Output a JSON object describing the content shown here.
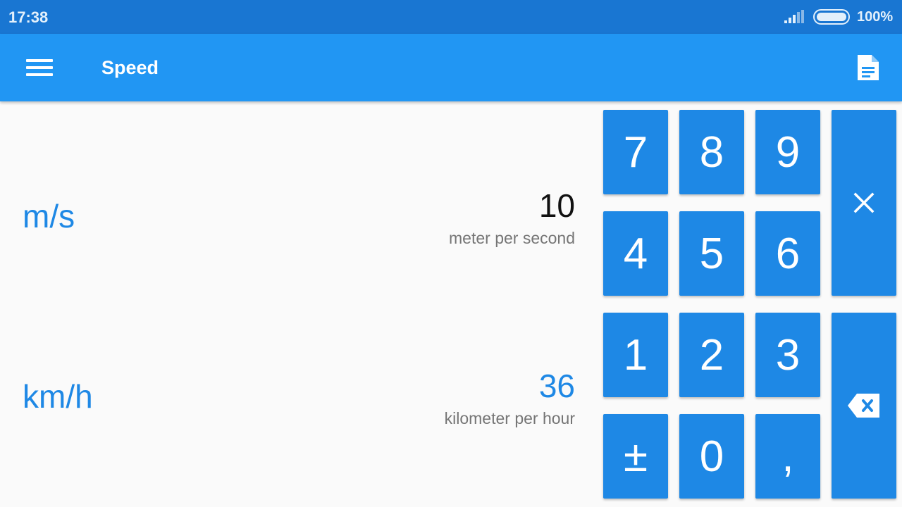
{
  "status": {
    "time": "17:38",
    "battery": "100%"
  },
  "app": {
    "title": "Speed",
    "menu_icon": "hamburger-menu-icon",
    "doc_icon": "document-icon"
  },
  "conversions": [
    {
      "unit": "m/s",
      "value": "10",
      "name": "meter per second",
      "value_color": "#111111"
    },
    {
      "unit": "km/h",
      "value": "36",
      "name": "kilometer per hour",
      "value_color": "#1e88e5"
    }
  ],
  "keypad": {
    "k7": "7",
    "k8": "8",
    "k9": "9",
    "k4": "4",
    "k5": "5",
    "k6": "6",
    "k1": "1",
    "k2": "2",
    "k3": "3",
    "plusminus": "±",
    "k0": "0",
    "comma": ",",
    "clear_icon": "close-icon",
    "backspace_icon": "backspace-icon"
  },
  "colors": {
    "statusbar": "#1976d2",
    "appbar": "#2196f3",
    "accent": "#1e88e5"
  }
}
